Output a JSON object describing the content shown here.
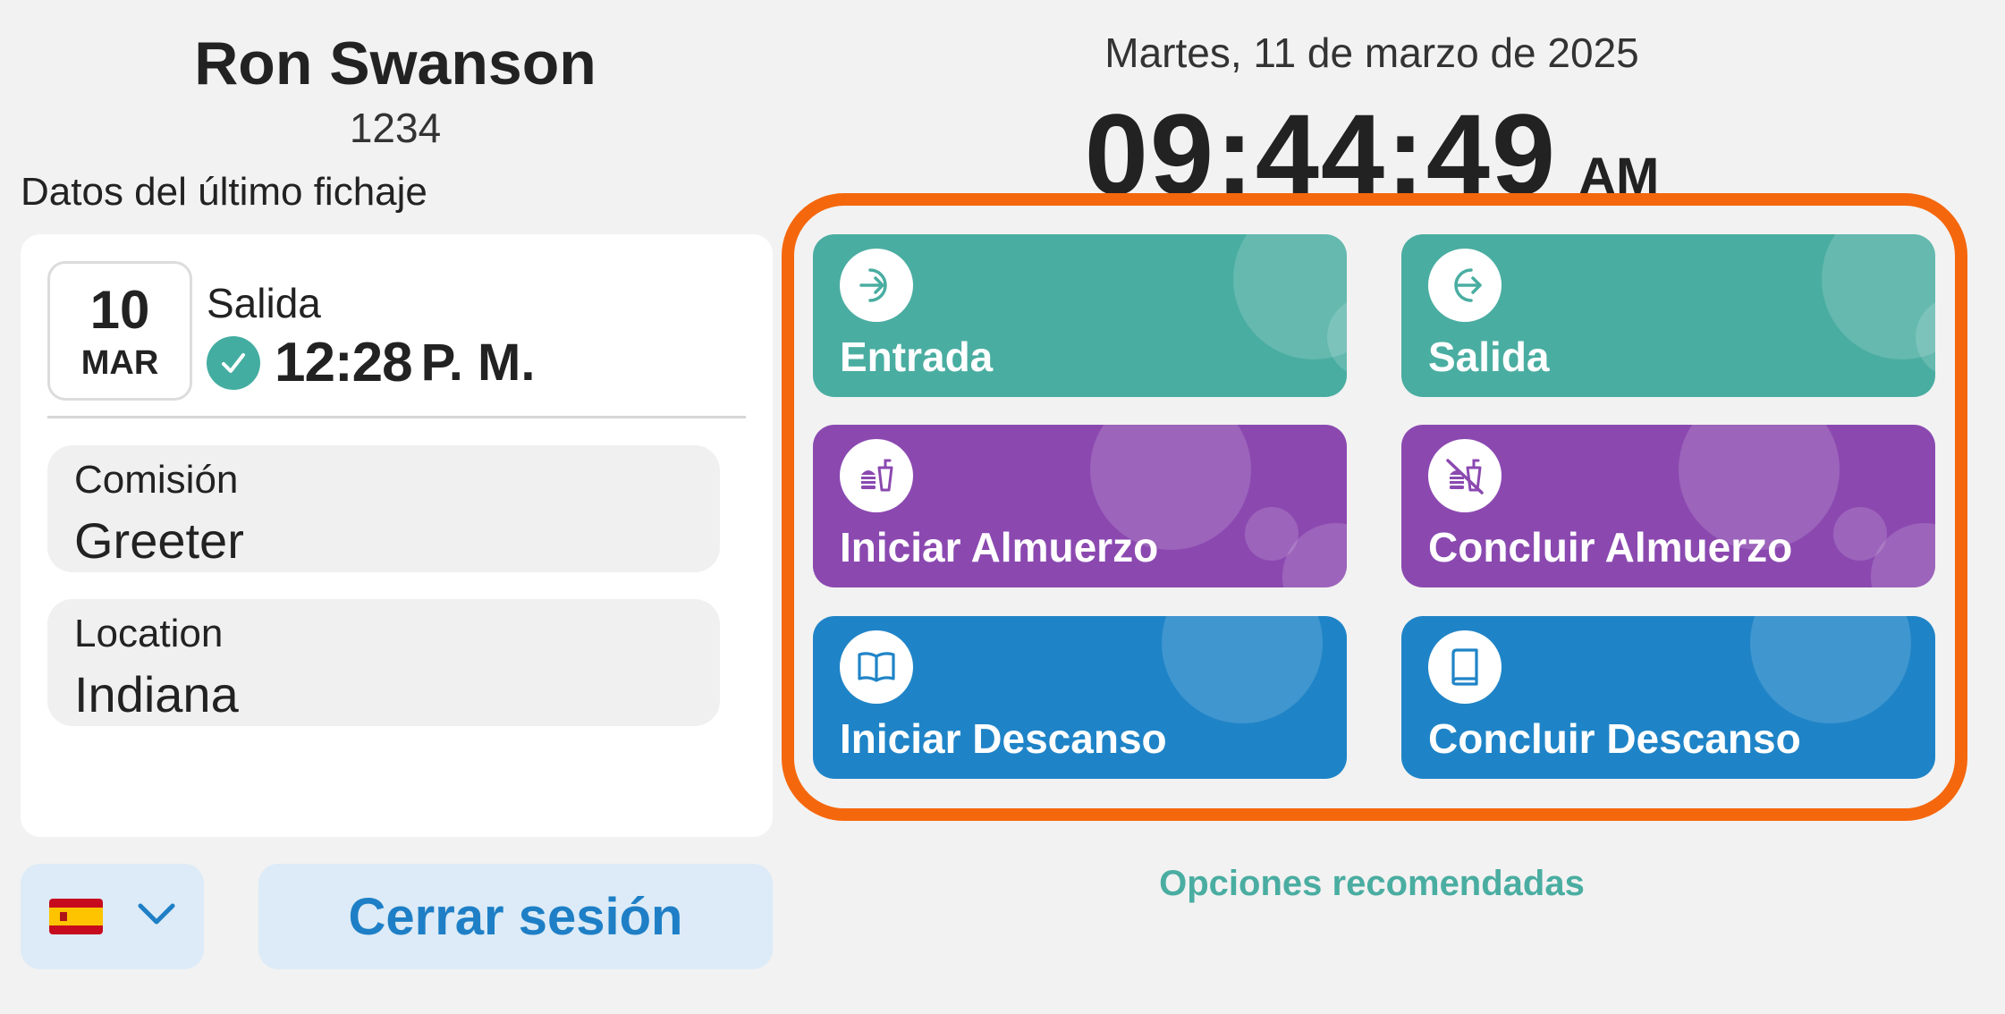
{
  "user": {
    "name": "Ron Swanson",
    "id": "1234"
  },
  "last_punch": {
    "section_title": "Datos del último fichaje",
    "day": "10",
    "month": "MAR",
    "type": "Salida",
    "time": "12:28",
    "ampm": "P. M.",
    "status_icon": "check-icon"
  },
  "fields": {
    "commission": {
      "label": "Comisión",
      "value": "Greeter"
    },
    "location": {
      "label": "Location",
      "value": "Indiana"
    }
  },
  "language": {
    "flag": "spain-flag",
    "icon": "chevron-down-icon"
  },
  "logout_label": "Cerrar sesión",
  "header": {
    "date": "Martes, 11 de marzo de 2025",
    "time": "09:44:49",
    "ampm": "AM"
  },
  "actions": {
    "clock_in": {
      "label": "Entrada",
      "icon": "sign-in-icon",
      "color": "#4aada1"
    },
    "clock_out": {
      "label": "Salida",
      "icon": "sign-out-icon",
      "color": "#4aada1"
    },
    "start_lunch": {
      "label": "Iniciar Almuerzo",
      "icon": "meal-icon",
      "color": "#8b49b0"
    },
    "end_lunch": {
      "label": "Concluir Almuerzo",
      "icon": "meal-off-icon",
      "color": "#8b49b0"
    },
    "start_break": {
      "label": "Iniciar Descanso",
      "icon": "book-open-icon",
      "color": "#1f84c7"
    },
    "end_break": {
      "label": "Concluir Descanso",
      "icon": "book-closed-icon",
      "color": "#1f84c7"
    }
  },
  "highlight_color": "#f5670d",
  "recommended_label": "Opciones recomendadas"
}
